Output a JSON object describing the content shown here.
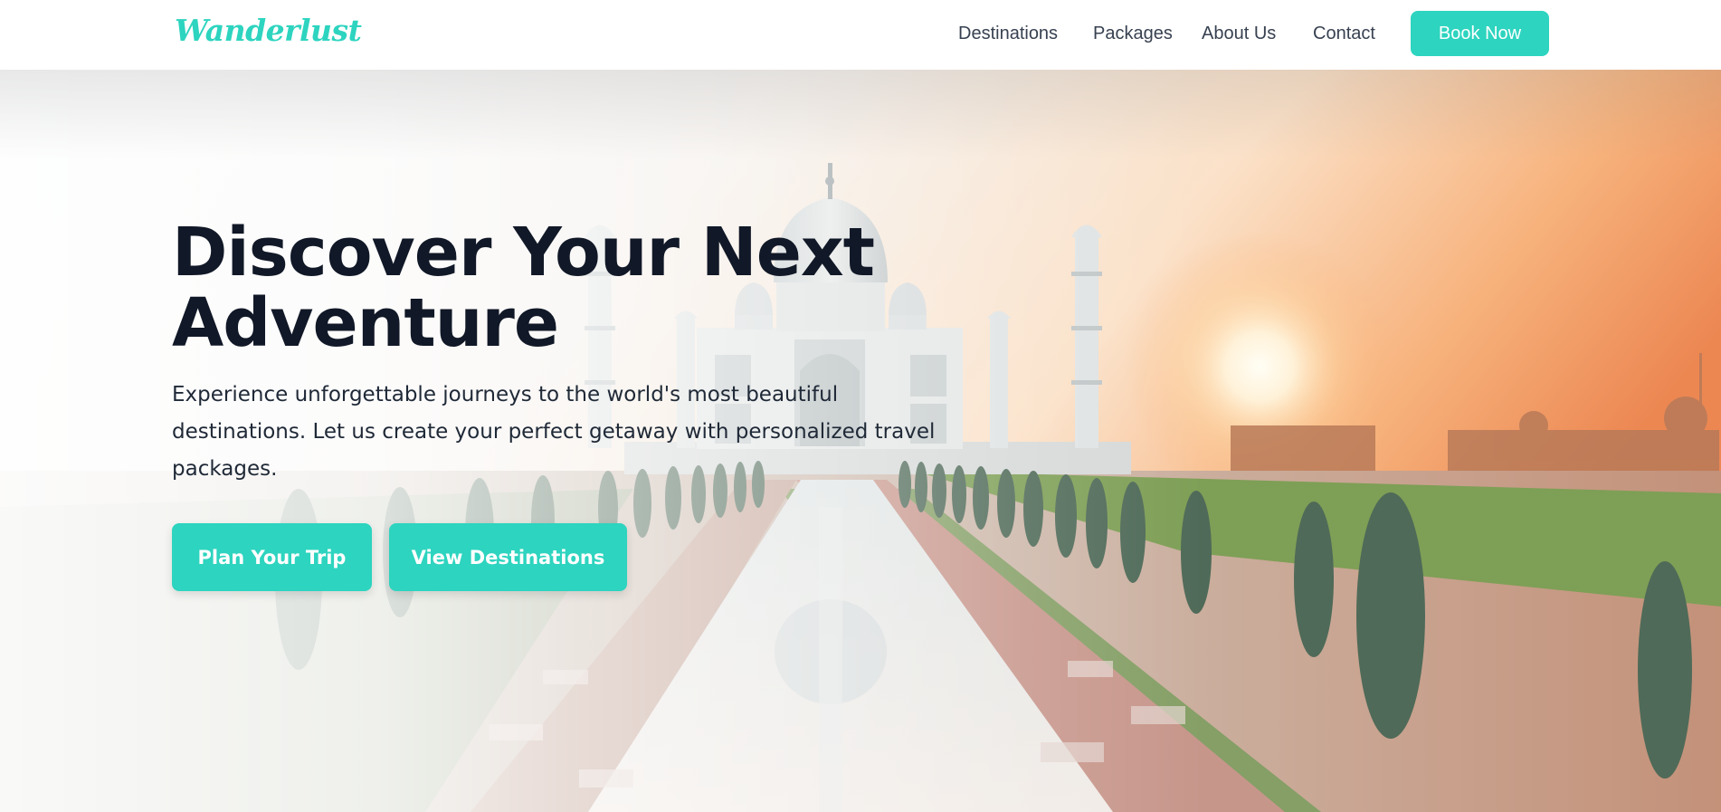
{
  "brand": {
    "logo_text": "Wanderlust",
    "accent_color": "#2dd4bf",
    "heading_color": "#111827",
    "nav_text_color": "#374151"
  },
  "nav": {
    "links": [
      "Destinations",
      "Packages",
      "About Us",
      "Contact"
    ],
    "cta_label": "Book Now"
  },
  "hero": {
    "title_lines": [
      "Discover Your Next",
      "Adventure"
    ],
    "description_lines": [
      "Experience unforgettable journeys to the world's most beautiful",
      "destinations. Let us create your perfect getaway with personalized travel",
      "packages."
    ],
    "primary_button": "Plan Your Trip",
    "secondary_button": "View Destinations",
    "background": "taj-mahal-sunrise-photo"
  }
}
